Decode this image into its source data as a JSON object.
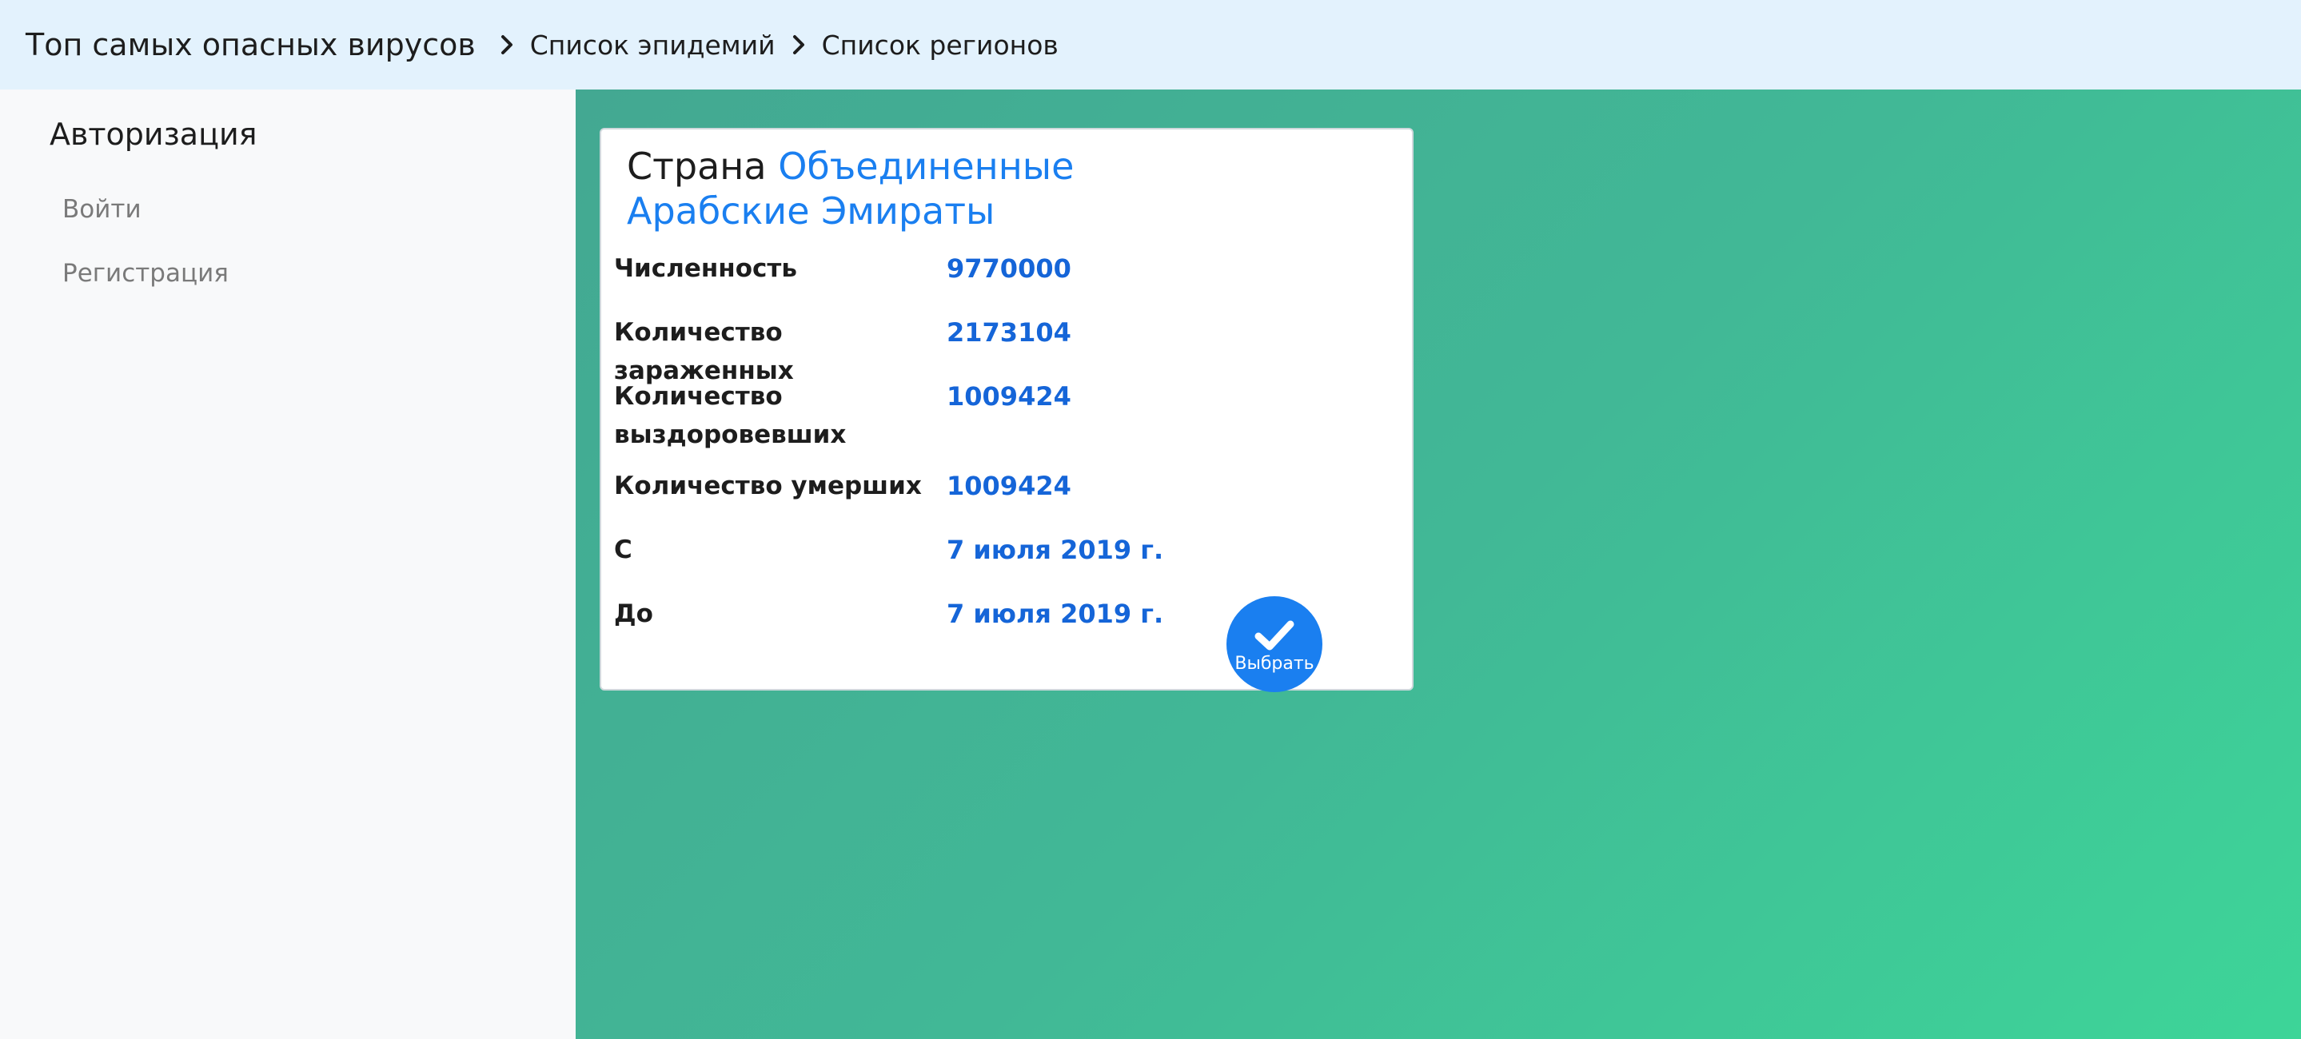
{
  "navbar": {
    "brand": "Топ самых опасных вирусов",
    "breadcrumbs": [
      {
        "label": "Список эпидемий"
      },
      {
        "label": "Список регионов"
      }
    ]
  },
  "sidebar": {
    "title": "Авторизация",
    "items": [
      {
        "label": "Войти"
      },
      {
        "label": "Регистрация"
      }
    ]
  },
  "card": {
    "title_prefix": "Страна",
    "country": "Объединенные Арабские Эмираты",
    "rows": [
      {
        "label": "Численность",
        "value": "9770000"
      },
      {
        "label": "Количество зараженных",
        "value": "2173104"
      },
      {
        "label": "Количество выздоровевших",
        "value": "1009424"
      },
      {
        "label": "Количество умерших",
        "value": "1009424"
      },
      {
        "label": "С",
        "value": "7 июля 2019 г."
      },
      {
        "label": "До",
        "value": "7 июля 2019 г."
      }
    ],
    "select_button": {
      "label": "Выбрать",
      "icon": "check-icon"
    }
  },
  "colors": {
    "navbar_bg": "#e3f2fd",
    "sidebar_bg": "#f8f9fa",
    "accent": "#1a7ff0",
    "value_blue": "#1565d8",
    "gradient_start": "#43a892",
    "gradient_end": "#3dd598"
  }
}
